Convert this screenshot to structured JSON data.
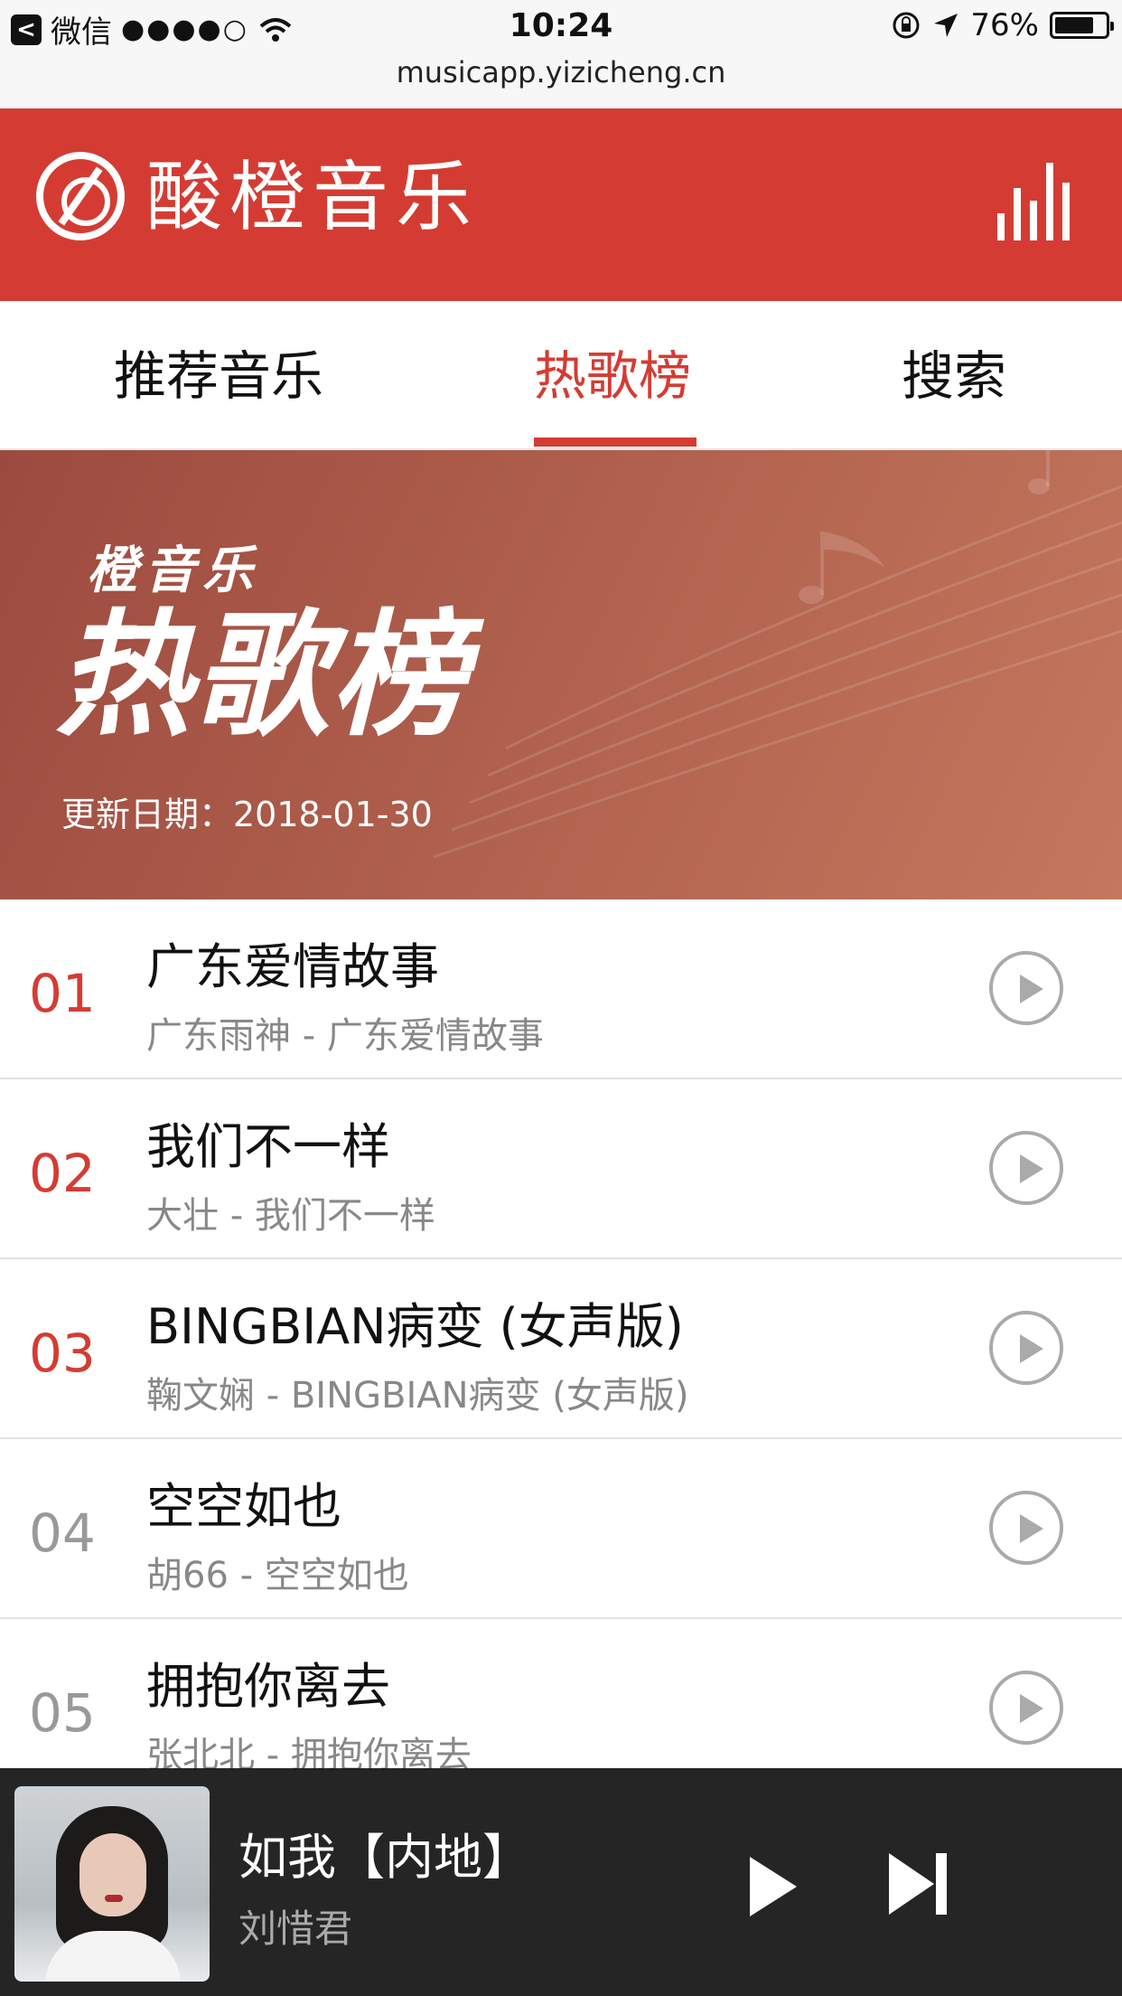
{
  "status_bar": {
    "back_app": "微信",
    "signal": "●●●●○",
    "time": "10:24",
    "battery": "76%",
    "battery_level": 0.76
  },
  "url": "musicapp.yizicheng.cn",
  "header": {
    "brand": "酸橙音乐"
  },
  "tabs": [
    {
      "label": "推荐音乐",
      "active": false
    },
    {
      "label": "热歌榜",
      "active": true
    },
    {
      "label": "搜索",
      "active": false
    }
  ],
  "banner": {
    "subtitle": "橙音乐",
    "title": "热歌榜",
    "update_date": "更新日期：2018-01-30"
  },
  "songs": [
    {
      "rank": "01",
      "title": "广东爱情故事",
      "meta": "广东雨神 - 广东爱情故事"
    },
    {
      "rank": "02",
      "title": "我们不一样",
      "meta": "大壮 - 我们不一样"
    },
    {
      "rank": "03",
      "title": "BINGBIAN病变 (女声版)",
      "meta": "鞠文娴 - BINGBIAN病变 (女声版)"
    },
    {
      "rank": "04",
      "title": "空空如也",
      "meta": "胡66 - 空空如也"
    },
    {
      "rank": "05",
      "title": "拥抱你离去",
      "meta": "张北北 - 拥抱你离去"
    }
  ],
  "player": {
    "title": "如我【内地】",
    "artist": "刘惜君"
  },
  "colors": {
    "accent": "#d43c33",
    "muted": "#888888",
    "player_bg": "#141414"
  }
}
